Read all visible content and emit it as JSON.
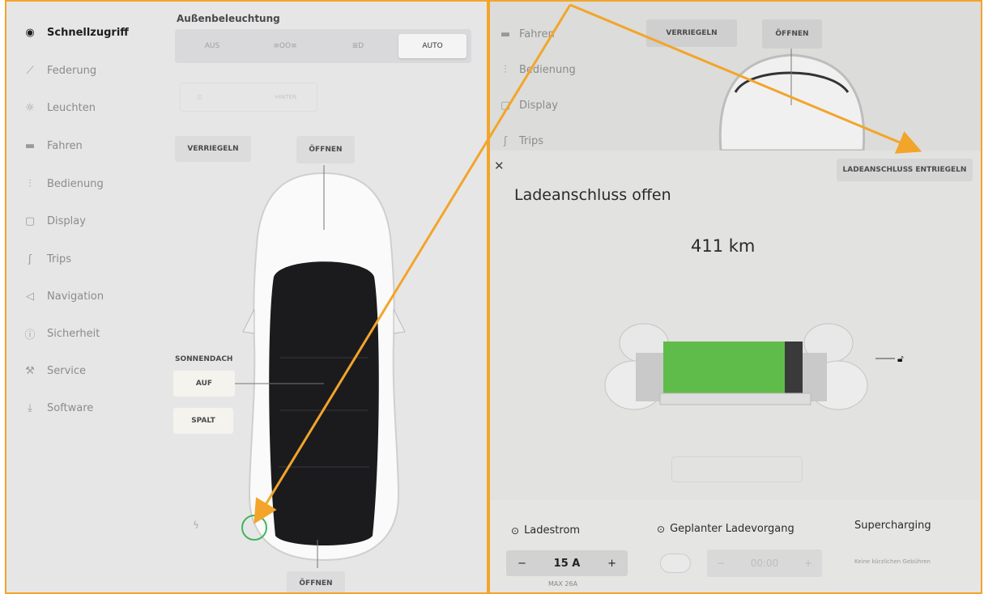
{
  "left": {
    "sidebar": {
      "items": [
        {
          "label": "Schnellzugriff",
          "icon": "toggle-icon",
          "active": true
        },
        {
          "label": "Federung",
          "icon": "suspension-icon"
        },
        {
          "label": "Leuchten",
          "icon": "sun-icon"
        },
        {
          "label": "Fahren",
          "icon": "car-icon"
        },
        {
          "label": "Bedienung",
          "icon": "sliders-icon"
        },
        {
          "label": "Display",
          "icon": "display-icon"
        },
        {
          "label": "Trips",
          "icon": "trips-icon"
        },
        {
          "label": "Navigation",
          "icon": "navigation-icon"
        },
        {
          "label": "Sicherheit",
          "icon": "info-icon"
        },
        {
          "label": "Service",
          "icon": "wrench-icon"
        },
        {
          "label": "Software",
          "icon": "download-icon"
        }
      ]
    },
    "lights": {
      "heading": "Außenbeleuchtung",
      "options": [
        {
          "label": "AUS"
        },
        {
          "label": "≡OO≡",
          "icon": "parking-lights-icon"
        },
        {
          "label": "≣D",
          "icon": "low-beam-icon"
        },
        {
          "label": "AUTO",
          "selected": true
        }
      ],
      "fog_label": "HINTEN"
    },
    "lock_button": "VERRIEGELN",
    "frunk_button": "ÖFFNEN",
    "sunroof": {
      "heading": "SONNENDACH",
      "open": "AUF",
      "vent": "SPALT"
    },
    "trunk_button": "ÖFFNEN"
  },
  "right": {
    "sidebar": [
      "Fahren",
      "Bedienung",
      "Display",
      "Trips"
    ],
    "lock_button": "VERRIEGELN",
    "frunk_button": "ÖFFNEN",
    "unlatch_button": "LADEANSCHLUSS ENTRIEGELN",
    "title": "Ladeanschluss offen",
    "range": "411 km",
    "charge_current": {
      "label": "Ladestrom",
      "value": "15 A",
      "minus": "−",
      "plus": "+",
      "max": "MAX 26A"
    },
    "scheduled": {
      "label": "Geplanter Ladevorgang",
      "time": "00:00",
      "minus": "−",
      "plus": "+"
    },
    "supercharging": {
      "label": "Supercharging",
      "note": "Keine kürzlichen Gebühren"
    }
  },
  "colors": {
    "annotation_arrow": "#f2a52a",
    "battery": "#5fbc4a",
    "charge_port_circle": "#3fb65c"
  }
}
